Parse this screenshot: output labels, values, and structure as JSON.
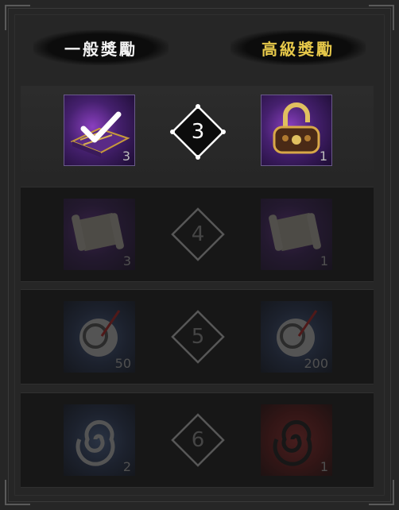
{
  "header": {
    "normal_label": "一般獎勵",
    "advanced_label": "高級獎勵"
  },
  "rows": [
    {
      "level": "3",
      "normal_qty": "3",
      "advanced_qty": "1",
      "normal_icon": "book-icon",
      "advanced_icon": "lock-icon",
      "state": "claimed"
    },
    {
      "level": "4",
      "normal_qty": "3",
      "advanced_qty": "1",
      "normal_icon": "scroll-icon",
      "advanced_icon": "scroll-icon",
      "state": "locked"
    },
    {
      "level": "5",
      "normal_qty": "50",
      "advanced_qty": "200",
      "normal_icon": "swirl-ring-icon",
      "advanced_icon": "swirl-ring-icon",
      "state": "locked"
    },
    {
      "level": "6",
      "normal_qty": "2",
      "advanced_qty": "1",
      "normal_icon": "swirl-icon",
      "advanced_icon": "swirl-icon",
      "state": "locked"
    }
  ],
  "colors": {
    "accent_gold": "#e6c84a",
    "panel_bg": "#262626",
    "item_purple": "#45206e",
    "item_red": "#7a1414"
  }
}
